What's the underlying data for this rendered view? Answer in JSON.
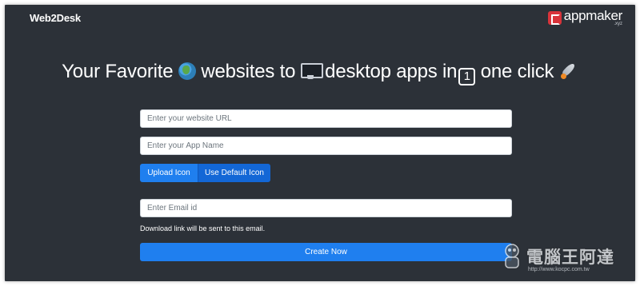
{
  "header": {
    "brand": "Web2Desk",
    "partner_name": "appmaker",
    "partner_suffix": ".xyz"
  },
  "hero": {
    "part1": "Your Favorite ",
    "icon1": "globe-icon",
    "part2": " websites to ",
    "icon2": "desktop-computer-icon",
    "part3": " desktop apps in",
    "keycap": "1",
    "part4": " one click ",
    "icon3": "rocket-icon"
  },
  "form": {
    "url_placeholder": "Enter your website URL",
    "appname_placeholder": "Enter your App Name",
    "upload_icon_label": "Upload Icon",
    "default_icon_label": "Use Default Icon",
    "email_placeholder": "Enter Email id",
    "email_helper": "Download link will be sent to this email.",
    "create_label": "Create Now"
  },
  "watermark": {
    "text": "電腦王阿達",
    "url": "http://www.kocpc.com.tw"
  },
  "colors": {
    "background": "#2c3138",
    "primary_button": "#1f7fef",
    "partner_logo": "#d8333a"
  }
}
